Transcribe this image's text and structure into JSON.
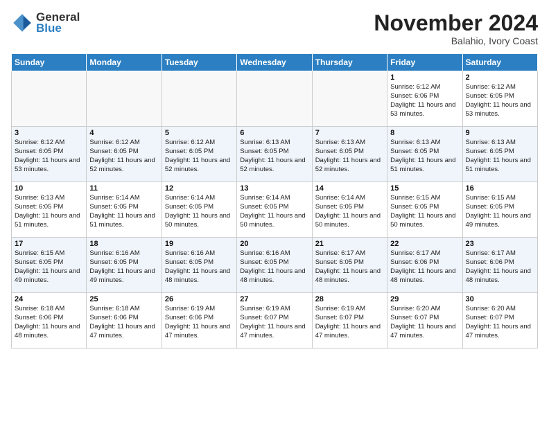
{
  "header": {
    "logo_line1": "General",
    "logo_line2": "Blue",
    "month": "November 2024",
    "location": "Balahio, Ivory Coast"
  },
  "days_of_week": [
    "Sunday",
    "Monday",
    "Tuesday",
    "Wednesday",
    "Thursday",
    "Friday",
    "Saturday"
  ],
  "weeks": [
    [
      {
        "day": "",
        "empty": true
      },
      {
        "day": "",
        "empty": true
      },
      {
        "day": "",
        "empty": true
      },
      {
        "day": "",
        "empty": true
      },
      {
        "day": "",
        "empty": true
      },
      {
        "day": "1",
        "sunrise": "6:12 AM",
        "sunset": "6:06 PM",
        "daylight": "11 hours and 53 minutes."
      },
      {
        "day": "2",
        "sunrise": "6:12 AM",
        "sunset": "6:05 PM",
        "daylight": "11 hours and 53 minutes."
      }
    ],
    [
      {
        "day": "3",
        "sunrise": "6:12 AM",
        "sunset": "6:05 PM",
        "daylight": "11 hours and 53 minutes."
      },
      {
        "day": "4",
        "sunrise": "6:12 AM",
        "sunset": "6:05 PM",
        "daylight": "11 hours and 52 minutes."
      },
      {
        "day": "5",
        "sunrise": "6:12 AM",
        "sunset": "6:05 PM",
        "daylight": "11 hours and 52 minutes."
      },
      {
        "day": "6",
        "sunrise": "6:13 AM",
        "sunset": "6:05 PM",
        "daylight": "11 hours and 52 minutes."
      },
      {
        "day": "7",
        "sunrise": "6:13 AM",
        "sunset": "6:05 PM",
        "daylight": "11 hours and 52 minutes."
      },
      {
        "day": "8",
        "sunrise": "6:13 AM",
        "sunset": "6:05 PM",
        "daylight": "11 hours and 51 minutes."
      },
      {
        "day": "9",
        "sunrise": "6:13 AM",
        "sunset": "6:05 PM",
        "daylight": "11 hours and 51 minutes."
      }
    ],
    [
      {
        "day": "10",
        "sunrise": "6:13 AM",
        "sunset": "6:05 PM",
        "daylight": "11 hours and 51 minutes."
      },
      {
        "day": "11",
        "sunrise": "6:14 AM",
        "sunset": "6:05 PM",
        "daylight": "11 hours and 51 minutes."
      },
      {
        "day": "12",
        "sunrise": "6:14 AM",
        "sunset": "6:05 PM",
        "daylight": "11 hours and 50 minutes."
      },
      {
        "day": "13",
        "sunrise": "6:14 AM",
        "sunset": "6:05 PM",
        "daylight": "11 hours and 50 minutes."
      },
      {
        "day": "14",
        "sunrise": "6:14 AM",
        "sunset": "6:05 PM",
        "daylight": "11 hours and 50 minutes."
      },
      {
        "day": "15",
        "sunrise": "6:15 AM",
        "sunset": "6:05 PM",
        "daylight": "11 hours and 50 minutes."
      },
      {
        "day": "16",
        "sunrise": "6:15 AM",
        "sunset": "6:05 PM",
        "daylight": "11 hours and 49 minutes."
      }
    ],
    [
      {
        "day": "17",
        "sunrise": "6:15 AM",
        "sunset": "6:05 PM",
        "daylight": "11 hours and 49 minutes."
      },
      {
        "day": "18",
        "sunrise": "6:16 AM",
        "sunset": "6:05 PM",
        "daylight": "11 hours and 49 minutes."
      },
      {
        "day": "19",
        "sunrise": "6:16 AM",
        "sunset": "6:05 PM",
        "daylight": "11 hours and 48 minutes."
      },
      {
        "day": "20",
        "sunrise": "6:16 AM",
        "sunset": "6:05 PM",
        "daylight": "11 hours and 48 minutes."
      },
      {
        "day": "21",
        "sunrise": "6:17 AM",
        "sunset": "6:05 PM",
        "daylight": "11 hours and 48 minutes."
      },
      {
        "day": "22",
        "sunrise": "6:17 AM",
        "sunset": "6:06 PM",
        "daylight": "11 hours and 48 minutes."
      },
      {
        "day": "23",
        "sunrise": "6:17 AM",
        "sunset": "6:06 PM",
        "daylight": "11 hours and 48 minutes."
      }
    ],
    [
      {
        "day": "24",
        "sunrise": "6:18 AM",
        "sunset": "6:06 PM",
        "daylight": "11 hours and 48 minutes."
      },
      {
        "day": "25",
        "sunrise": "6:18 AM",
        "sunset": "6:06 PM",
        "daylight": "11 hours and 47 minutes."
      },
      {
        "day": "26",
        "sunrise": "6:19 AM",
        "sunset": "6:06 PM",
        "daylight": "11 hours and 47 minutes."
      },
      {
        "day": "27",
        "sunrise": "6:19 AM",
        "sunset": "6:07 PM",
        "daylight": "11 hours and 47 minutes."
      },
      {
        "day": "28",
        "sunrise": "6:19 AM",
        "sunset": "6:07 PM",
        "daylight": "11 hours and 47 minutes."
      },
      {
        "day": "29",
        "sunrise": "6:20 AM",
        "sunset": "6:07 PM",
        "daylight": "11 hours and 47 minutes."
      },
      {
        "day": "30",
        "sunrise": "6:20 AM",
        "sunset": "6:07 PM",
        "daylight": "11 hours and 47 minutes."
      }
    ]
  ],
  "labels": {
    "sunrise": "Sunrise:",
    "sunset": "Sunset:",
    "daylight": "Daylight:"
  }
}
